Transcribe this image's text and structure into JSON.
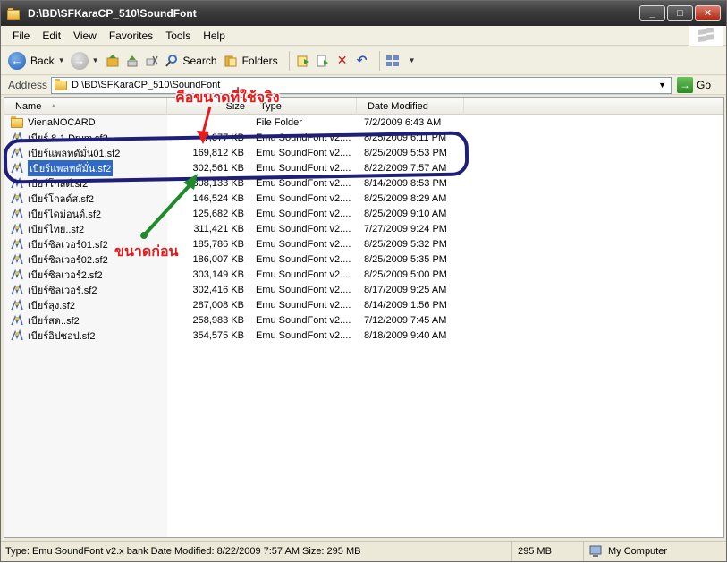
{
  "window": {
    "title": "D:\\BD\\SFKaraCP_510\\SoundFont",
    "controls": {
      "minimize": "_",
      "maximize": "□",
      "close": "✕"
    }
  },
  "menu": [
    "File",
    "Edit",
    "View",
    "Favorites",
    "Tools",
    "Help"
  ],
  "toolbar": {
    "back_label": "Back",
    "search_label": "Search",
    "folders_label": "Folders"
  },
  "address": {
    "label": "Address",
    "value": "D:\\BD\\SFKaraCP_510\\SoundFont",
    "go_label": "Go"
  },
  "columns": {
    "name": "Name",
    "size": "Size",
    "type": "Type",
    "date": "Date Modified"
  },
  "files": [
    {
      "name": "VienaNOCARD",
      "size": "",
      "type": "File Folder",
      "date": "7/2/2009 6:43 AM",
      "kind": "folder"
    },
    {
      "name": "เบียร์ 8-1 Drum.sf2",
      "size": "?,877 KB",
      "type": "Emu SoundFont v2....",
      "date": "8/25/2009 6:11 PM",
      "kind": "sf"
    },
    {
      "name": "เบียร์แพลทดัมั่น01.sf2",
      "size": "169,812 KB",
      "type": "Emu SoundFont v2....",
      "date": "8/25/2009 5:53 PM",
      "kind": "sf"
    },
    {
      "name": "เบียร์แพลทดัมั่น.sf2",
      "size": "302,561 KB",
      "type": "Emu SoundFont v2....",
      "date": "8/22/2009 7:57 AM",
      "kind": "sf",
      "selected": true
    },
    {
      "name": "เบียร์โกลด์.sf2",
      "size": "308,133 KB",
      "type": "Emu SoundFont v2....",
      "date": "8/14/2009 8:53 PM",
      "kind": "sf"
    },
    {
      "name": "เบียร์โกลด์ส.sf2",
      "size": "146,524 KB",
      "type": "Emu SoundFont v2....",
      "date": "8/25/2009 8:29 AM",
      "kind": "sf"
    },
    {
      "name": "เบียร์ไดม่อนด์.sf2",
      "size": "125,682 KB",
      "type": "Emu SoundFont v2....",
      "date": "8/25/2009 9:10 AM",
      "kind": "sf"
    },
    {
      "name": "เบียร์ไทย..sf2",
      "size": "311,421 KB",
      "type": "Emu SoundFont v2....",
      "date": "7/27/2009 9:24 PM",
      "kind": "sf"
    },
    {
      "name": "เบียร์ซิลเวอร์01.sf2",
      "size": "185,786 KB",
      "type": "Emu SoundFont v2....",
      "date": "8/25/2009 5:32 PM",
      "kind": "sf"
    },
    {
      "name": "เบียร์ซิลเวอร์02.sf2",
      "size": "186,007 KB",
      "type": "Emu SoundFont v2....",
      "date": "8/25/2009 5:35 PM",
      "kind": "sf"
    },
    {
      "name": "เบียร์ซิลเวอร์2.sf2",
      "size": "303,149 KB",
      "type": "Emu SoundFont v2....",
      "date": "8/25/2009 5:00 PM",
      "kind": "sf"
    },
    {
      "name": "เบียร์ซิลเวอร์.sf2",
      "size": "302,416 KB",
      "type": "Emu SoundFont v2....",
      "date": "8/17/2009 9:25 AM",
      "kind": "sf"
    },
    {
      "name": "เบียร์ลุง.sf2",
      "size": "287,008 KB",
      "type": "Emu SoundFont v2....",
      "date": "8/14/2009 1:56 PM",
      "kind": "sf"
    },
    {
      "name": "เบียร์สด..sf2",
      "size": "258,983 KB",
      "type": "Emu SoundFont v2....",
      "date": "7/12/2009 7:45 AM",
      "kind": "sf"
    },
    {
      "name": "เบียร์อิปซอป.sf2",
      "size": "354,575 KB",
      "type": "Emu SoundFont v2....",
      "date": "8/18/2009 9:40 AM",
      "kind": "sf"
    }
  ],
  "annotations": {
    "red_text": "คือขนาดที่ใช้จริง",
    "green_text": "ขนาดก่อน"
  },
  "status": {
    "main": "Type: Emu SoundFont v2.x bank Date Modified: 8/22/2009 7:57 AM Size: 295 MB",
    "size": "295 MB",
    "zone": "My Computer"
  }
}
